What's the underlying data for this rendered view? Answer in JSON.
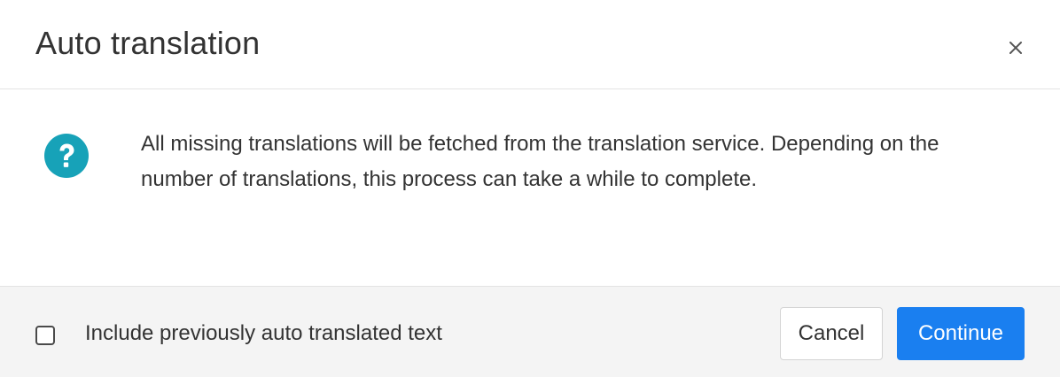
{
  "dialog": {
    "title": "Auto translation",
    "close_icon": "close-icon",
    "help_icon": "question-circle-icon",
    "message": "All missing translations will be fetched from the translation service. Depending on the number of translations, this process can take a while to complete.",
    "checkbox": {
      "label": "Include previously auto translated text",
      "checked": false
    },
    "buttons": {
      "cancel": "Cancel",
      "continue": "Continue"
    }
  },
  "colors": {
    "accent": "#1a7ff0",
    "help_icon": "#17a2b8",
    "footer_bg": "#f4f4f4",
    "divider": "#e3e3e3",
    "text": "#333333"
  }
}
